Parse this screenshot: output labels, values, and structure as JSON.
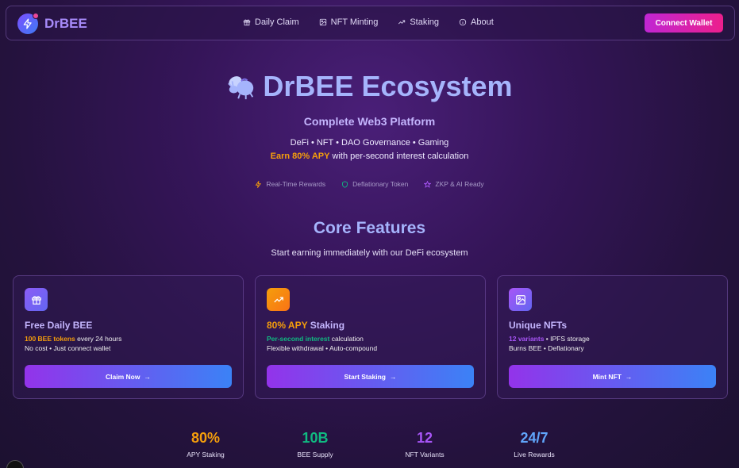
{
  "nav": {
    "brand": "DrBEE",
    "links": [
      {
        "label": "Daily Claim",
        "icon": "gift-icon"
      },
      {
        "label": "NFT Minting",
        "icon": "image-icon"
      },
      {
        "label": "Staking",
        "icon": "trending-up-icon"
      },
      {
        "label": "About",
        "icon": "info-icon"
      }
    ],
    "connect_label": "Connect Wallet"
  },
  "hero": {
    "title": "DrBEE Ecosystem",
    "subtitle": "Complete Web3 Platform",
    "tags": "DeFi • NFT • DAO Governance • Gaming",
    "apy_highlight": "Earn 80% APY",
    "apy_rest": " with per-second interest calculation",
    "badges": [
      {
        "label": "Real-Time Rewards",
        "icon": "lightning-icon",
        "color": "#f59e0b"
      },
      {
        "label": "Deflationary Token",
        "icon": "shield-icon",
        "color": "#10b981"
      },
      {
        "label": "ZKP & AI Ready",
        "icon": "star-icon",
        "color": "#a855f7"
      }
    ]
  },
  "features": {
    "title": "Core Features",
    "subtitle": "Start earning immediately with our DeFi ecosystem",
    "cards": [
      {
        "title": "Free Daily BEE",
        "title_highlight": "",
        "line1_highlight": "100 BEE tokens",
        "line1_highlight_color": "#f59e0b",
        "line1_rest": " every 24 hours",
        "line2": "No cost • Just connect wallet",
        "button": "Claim Now",
        "icon": "gift-icon"
      },
      {
        "title": " Staking",
        "title_highlight": "80% APY",
        "line1_highlight": "Per-second interest",
        "line1_highlight_color": "#10b981",
        "line1_rest": " calculation",
        "line2": "Flexible withdrawal • Auto-compound",
        "button": "Start Staking",
        "icon": "trending-up-icon"
      },
      {
        "title": "Unique NFTs",
        "title_highlight": "",
        "line1_highlight": "12 variants",
        "line1_highlight_color": "#a855f7",
        "line1_rest": " • IPFS storage",
        "line2": "Burns BEE • Deflationary",
        "button": "Mint NFT",
        "icon": "image-icon"
      }
    ]
  },
  "stats": [
    {
      "value": "80%",
      "label": "APY Staking",
      "color": "#f59e0b"
    },
    {
      "value": "10B",
      "label": "BEE Supply",
      "color": "#10b981"
    },
    {
      "value": "12",
      "label": "NFT Variants",
      "color": "#a855f7"
    },
    {
      "value": "24/7",
      "label": "Live Rewards",
      "color": "#60a5fa"
    }
  ]
}
